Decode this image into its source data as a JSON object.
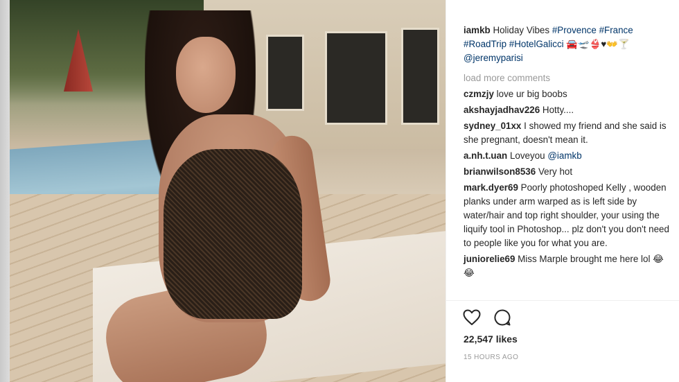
{
  "post": {
    "caption": {
      "username": "iamkb",
      "text": "Holiday Vibes",
      "tags": [
        "#Provence",
        "#France",
        "#RoadTrip",
        "#HotelGalicci"
      ],
      "emoji": "🚘🛫👙♥👐🍸",
      "mention": "@jeremyparisi"
    },
    "load_more_label": "load more comments",
    "comments": [
      {
        "user": "czmzjy",
        "text": "love ur big boobs"
      },
      {
        "user": "akshayjadhav226",
        "text": "Hotty...."
      },
      {
        "user": "sydney_01xx",
        "text": "I showed my friend and she said is she pregnant, doesn't mean it."
      },
      {
        "user": "a.nh.t.uan",
        "text": "Loveyou",
        "mention": "@iamkb"
      },
      {
        "user": "brianwilson8536",
        "text": "Very hot"
      },
      {
        "user": "mark.dyer69",
        "text": "Poorly photoshoped Kelly , wooden planks under arm warped as is left side by water/hair and top right shoulder, your using the liquify tool in Photoshop... plz don't you don't need to people like you for what you are."
      },
      {
        "user": "juniorelie69",
        "text": "Miss Marple brought me here lol 😂😂"
      }
    ],
    "actions": {
      "like_icon": "heart-outline-icon",
      "comment_icon": "speech-bubble-icon"
    },
    "likes": "22,547 likes",
    "timestamp": "15 HOURS AGO"
  },
  "colors": {
    "link": "#003569",
    "text": "#262626",
    "muted": "#999999"
  }
}
